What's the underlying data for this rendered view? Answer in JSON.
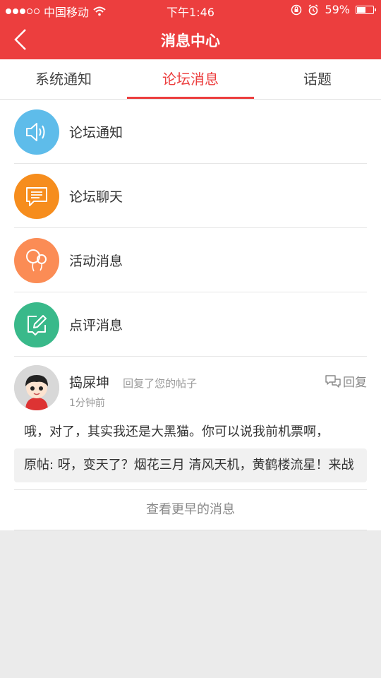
{
  "status": {
    "carrier": "中国移动",
    "time": "下午1:46",
    "battery": "59%",
    "battery_level": 0.59
  },
  "nav": {
    "title": "消息中心"
  },
  "tabs": [
    {
      "label": "系统通知"
    },
    {
      "label": "论坛消息"
    },
    {
      "label": "话题"
    }
  ],
  "categories": [
    {
      "label": "论坛通知",
      "icon": "speaker-icon",
      "color": "#5ebcea"
    },
    {
      "label": "论坛聊天",
      "icon": "chat-icon",
      "color": "#f68d1d"
    },
    {
      "label": "活动消息",
      "icon": "balloon-icon",
      "color": "#fb8c55"
    },
    {
      "label": "点评消息",
      "icon": "edit-icon",
      "color": "#39b98a"
    }
  ],
  "message": {
    "name": "捣屎坤",
    "action": "回复了您的帖子",
    "time": "1分钟前",
    "reply_label": "回复",
    "text": "哦，对了，其实我还是大黑猫。你可以说我前机票啊，",
    "quote": "原帖: 呀，变天了？烟花三月 清风天机，黄鹤楼流星！来战"
  },
  "more_label": "查看更早的消息",
  "colors": {
    "brand": "#ec3e3e"
  }
}
